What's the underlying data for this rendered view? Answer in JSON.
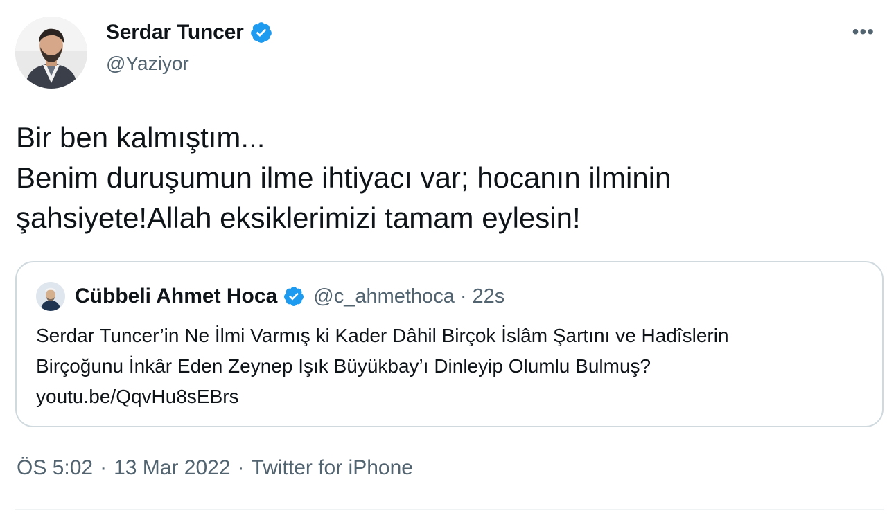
{
  "author": {
    "name": "Serdar Tuncer",
    "handle": "@Yaziyor",
    "verified": true
  },
  "menu_glyph": "•••",
  "tweet": {
    "lines": [
      "Bir ben kalmıştım...",
      "Benim duruşumun ilme ihtiyacı var; hocanın ilminin",
      "şahsiyete!Allah eksiklerimizi tamam eylesin!"
    ]
  },
  "quoted": {
    "name": "Cübbeli Ahmet Hoca",
    "handle": "@c_ahmethoca",
    "separator": "·",
    "time": "22s",
    "verified": true,
    "lines": [
      "Serdar Tuncer’in Ne İlmi Varmış ki Kader Dâhil Birçok İslâm Şartını ve Hadîslerin",
      "Birçoğunu İnkâr Eden Zeynep Işık Büyükbay’ı Dinleyip Olumlu Bulmuş?",
      "youtu.be/QqvHu8sEBrs"
    ]
  },
  "meta": {
    "time": "ÖS 5:02",
    "sep1": "·",
    "date": "13 Mar 2022",
    "sep2": "·",
    "source": "Twitter for iPhone"
  },
  "colors": {
    "verified_blue": "#1d9bf0",
    "text": "#0f1419",
    "secondary": "#536471",
    "border": "#cfd9de"
  }
}
